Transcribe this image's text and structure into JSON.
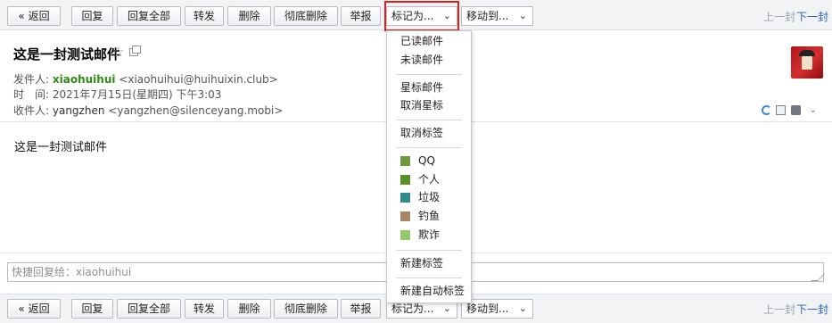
{
  "toolbar": {
    "back": "« 返回",
    "reply": "回复",
    "reply_all": "回复全部",
    "forward": "转发",
    "delete": "删除",
    "delete_forever": "彻底删除",
    "report": "举报",
    "mark_as": "标记为...",
    "move_to": "移动到...",
    "prev": "上一封",
    "next": "下一封"
  },
  "message": {
    "subject": "这是一封测试邮件",
    "from_label": "发件人:",
    "from_name": "xiaohuihui",
    "from_addr": "<xiaohuihui@huihuixin.club>",
    "time_label": "时　间:",
    "time_value": "2021年7月15日(星期四) 下午3:03",
    "to_label": "收件人:",
    "to_name": "yangzhen",
    "to_addr": "<yangzhen@silenceyang.mobi>",
    "body": "这是一封测试邮件"
  },
  "quick_reply": {
    "placeholder": "快捷回复给：xiaohuihui"
  },
  "mark_menu": {
    "read": "已读邮件",
    "unread": "未读邮件",
    "star": "星标邮件",
    "unstar": "取消星标",
    "remove_tag": "取消标签",
    "tags": [
      {
        "label": "QQ",
        "color": "#6d9a3d"
      },
      {
        "label": "个人",
        "color": "#5a8f28"
      },
      {
        "label": "垃圾",
        "color": "#2e8c8a"
      },
      {
        "label": "钓鱼",
        "color": "#a98763"
      },
      {
        "label": "欺诈",
        "color": "#93c968"
      }
    ],
    "new_tag": "新建标签",
    "new_auto_tag": "新建自动标签"
  },
  "icons": {
    "star": "star-icon",
    "popout": "popout-window-icon",
    "refresh": "refresh-icon",
    "note": "note-icon",
    "print": "print-icon",
    "more": "chevron-double-down-icon"
  },
  "colors": {
    "highlight": "#e02020",
    "sender": "#2e8b16",
    "link": "#2a63b8"
  }
}
